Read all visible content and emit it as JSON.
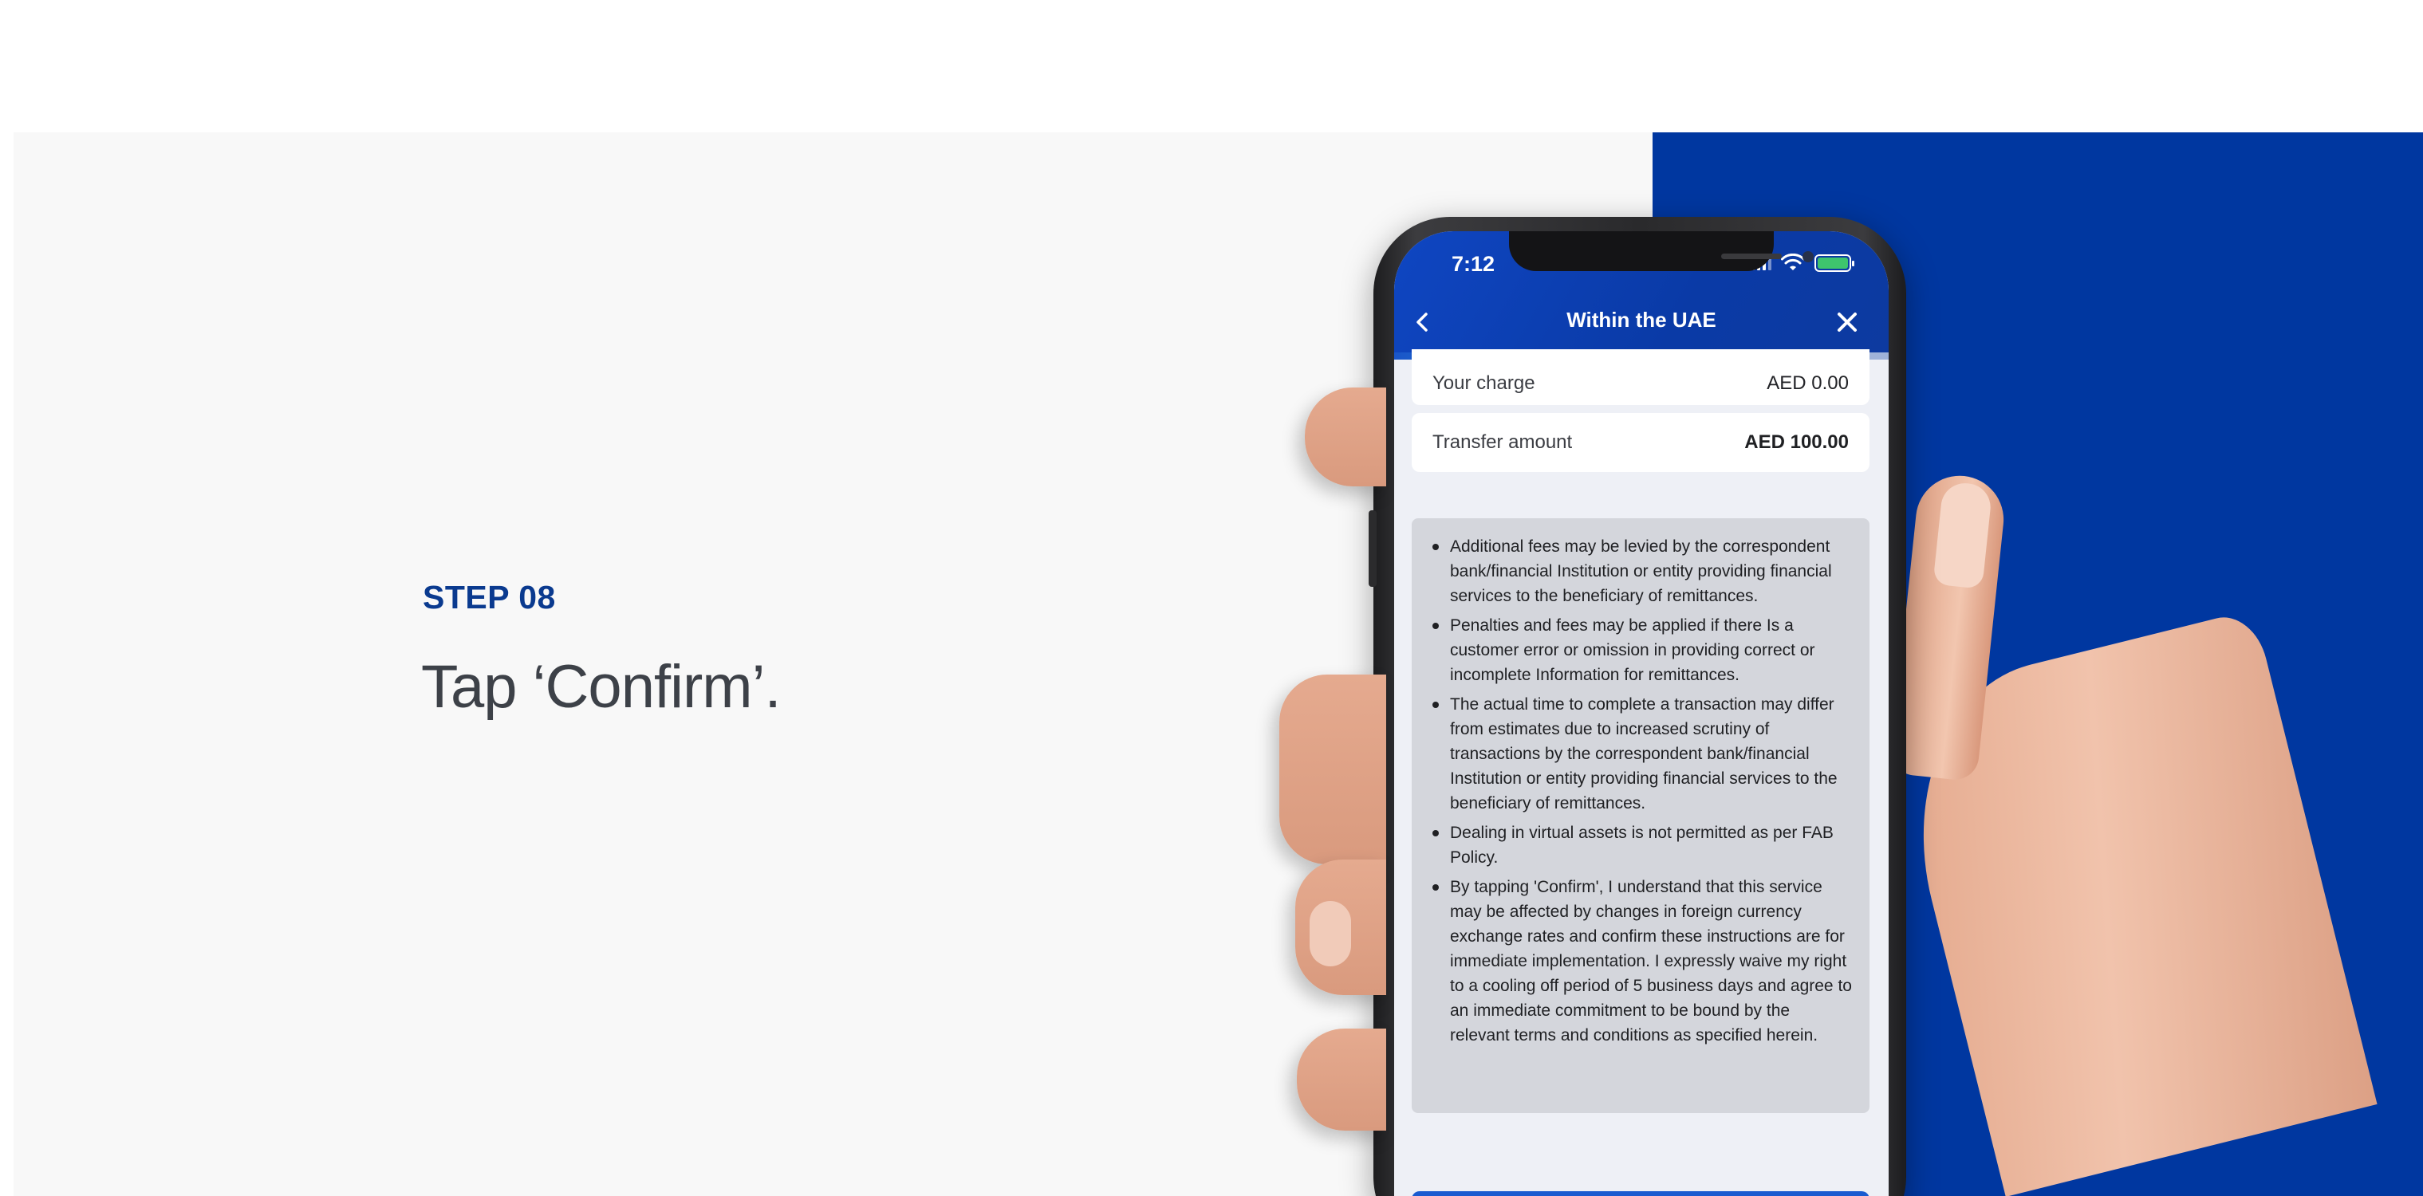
{
  "step": {
    "label": "STEP 08",
    "title": "Tap ‘Confirm’."
  },
  "colors": {
    "brand_blue": "#0037a0",
    "step_label": "#0a3a8f",
    "header_blue": "#0a3aa6",
    "progress_accent": "#33c4e6"
  },
  "status_bar": {
    "time": "7:12",
    "icons": [
      "cellular-signal-icon",
      "wifi-icon",
      "battery-charging-icon"
    ]
  },
  "header": {
    "title": "Within the UAE",
    "back_icon": "chevron-left-icon",
    "close_icon": "close-icon",
    "progress": 0.66
  },
  "summary": {
    "your_charge_label": "Your charge",
    "your_charge_value": "AED 0.00",
    "transfer_amount_label": "Transfer amount",
    "transfer_amount_value": "AED 100.00"
  },
  "disclaimer": {
    "items": [
      "Additional fees may be levied by the correspondent bank/financial Institution or entity providing financial services to the beneficiary of remittances.",
      "Penalties and fees may be applied if there Is a customer error or omission in providing correct or incomplete Information for remittances.",
      "The actual time to complete a transaction may differ from estimates due to increased scrutiny of transactions by the correspondent bank/financial Institution or entity providing financial services to the beneficiary of remittances.",
      "Dealing in virtual assets is not permitted as per FAB Policy.",
      "By tapping 'Confirm', I understand that this service may be affected by changes in foreign currency exchange rates and confirm these instructions are for immediate implementation. I expressly waive my right to a cooling off period of 5 business days and agree to an immediate commitment to be bound by the relevant terms and conditions as specified herein."
    ]
  }
}
